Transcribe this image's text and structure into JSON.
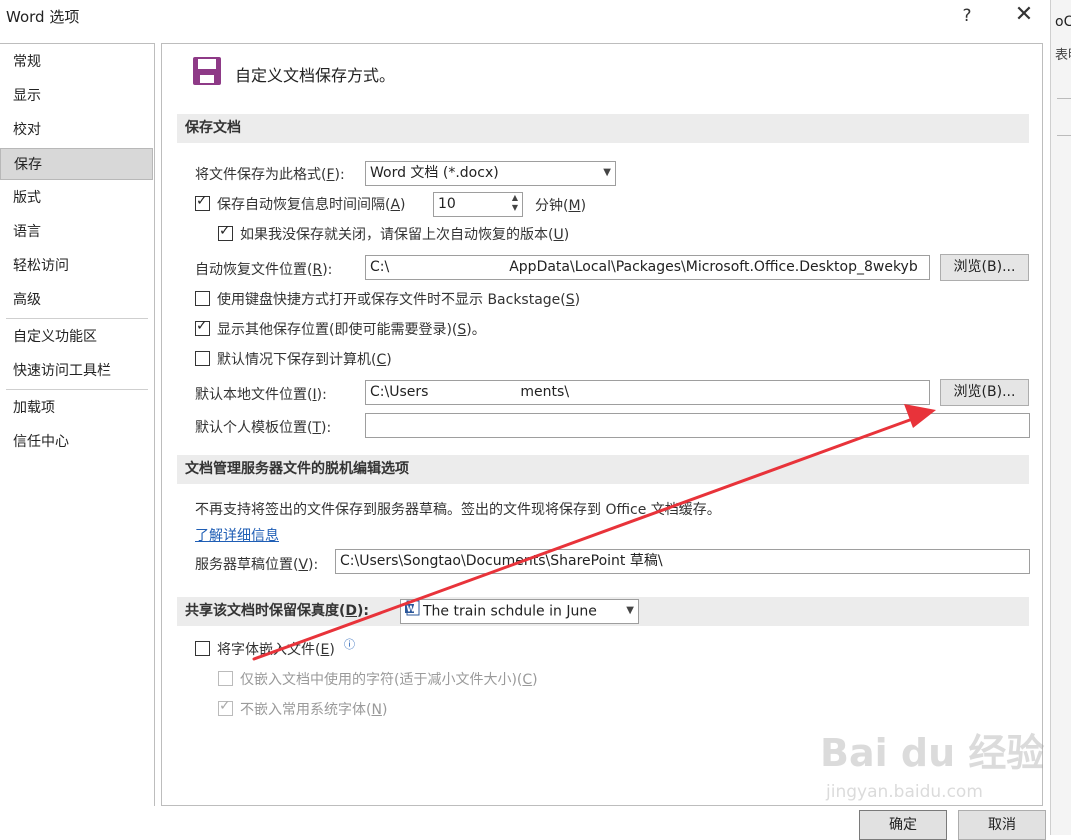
{
  "window": {
    "title": "Word 选项",
    "help_label": "?",
    "close_label": "✕"
  },
  "background_window": {
    "text1": "oCo",
    "text2": "表明"
  },
  "sidebar": {
    "items": [
      {
        "label": "常规",
        "active": false
      },
      {
        "label": "显示",
        "active": false
      },
      {
        "label": "校对",
        "active": false
      },
      {
        "label": "保存",
        "active": true
      },
      {
        "label": "版式",
        "active": false
      },
      {
        "label": "语言",
        "active": false
      },
      {
        "label": "轻松访问",
        "active": false
      },
      {
        "label": "高级",
        "active": false
      },
      {
        "label": "自定义功能区",
        "active": false
      },
      {
        "label": "快速访问工具栏",
        "active": false
      },
      {
        "label": "加载项",
        "active": false
      },
      {
        "label": "信任中心",
        "active": false
      }
    ]
  },
  "main": {
    "heading": "自定义文档保存方式。",
    "save_docs": {
      "header": "保存文档",
      "format_label": "将文件保存为此格式(",
      "format_key": "F",
      "format_label_end": "):",
      "format_value": "Word 文档 (*.docx)",
      "autorecover_label": "保存自动恢复信息时间间隔(",
      "autorecover_key": "A",
      "autorecover_end": ")",
      "autorecover_checked": true,
      "autorecover_minutes": "10",
      "minutes_label": "分钟(",
      "minutes_key": "M",
      "minutes_end": ")",
      "keep_last_label": "如果我没保存就关闭，请保留上次自动恢复的版本(",
      "keep_last_key": "U",
      "keep_last_end": ")",
      "keep_last_checked": true,
      "autorecover_location_label": "自动恢复文件位置(",
      "autorecover_location_key": "R",
      "autorecover_location_end": "):",
      "autorecover_location_prefix": "C:\\",
      "autorecover_location_suffix": "AppData\\Local\\Packages\\Microsoft.Office.Desktop_8wekyb",
      "browse1_label": "浏览(B)...",
      "no_backstage_label": "使用键盘快捷方式打开或保存文件时不显示 Backstage(",
      "no_backstage_key": "S",
      "no_backstage_end": ")",
      "no_backstage_checked": false,
      "show_other_label": "显示其他保存位置(即使可能需要登录)(",
      "show_other_key": "S",
      "show_other_end": ")。",
      "show_other_checked": true,
      "save_to_pc_label": "默认情况下保存到计算机(",
      "save_to_pc_key": "C",
      "save_to_pc_end": ")",
      "save_to_pc_checked": false,
      "default_local_label": "默认本地文件位置(",
      "default_local_key": "I",
      "default_local_end": "):",
      "default_local_prefix": "C:\\Users",
      "default_local_suffix": "ments\\",
      "browse2_label": "浏览(B)...",
      "default_template_label": "默认个人模板位置(",
      "default_template_key": "T",
      "default_template_end": "):",
      "default_template_value": ""
    },
    "offline_editing": {
      "header": "文档管理服务器文件的脱机编辑选项",
      "info_text": "不再支持将签出的文件保存到服务器草稿。签出的文件现将保存到 Office 文档缓存。",
      "learn_more_link": "了解详细信息",
      "server_drafts_label": "服务器草稿位置(",
      "server_drafts_key": "V",
      "server_drafts_end": "):",
      "server_drafts_value": "C:\\Users\\Songtao\\Documents\\SharePoint 草稿\\"
    },
    "fidelity": {
      "header": "共享该文档时保留保真度(",
      "header_key": "D",
      "header_end": "):",
      "document_value": "The train schdule in June",
      "embed_fonts_label": "将字体嵌入文件(",
      "embed_fonts_key": "E",
      "embed_fonts_end": ")",
      "embed_fonts_checked": false,
      "embed_used_label": "仅嵌入文档中使用的字符(适于减小文件大小)(",
      "embed_used_key": "C",
      "embed_used_end": ")",
      "embed_used_checked": false,
      "no_common_label": "不嵌入常用系统字体(",
      "no_common_key": "N",
      "no_common_end": ")",
      "no_common_checked": true
    }
  },
  "footer": {
    "ok_label": "确定",
    "cancel_label": "取消"
  },
  "watermark": {
    "line1": "Bai du 经验",
    "line2": "jingyan.baidu.com"
  },
  "colors": {
    "annotation_arrow": "#e8333a",
    "link": "#1f5eb5",
    "section_header_bg": "#ececec",
    "active_nav_bg": "#d8d8d8"
  }
}
